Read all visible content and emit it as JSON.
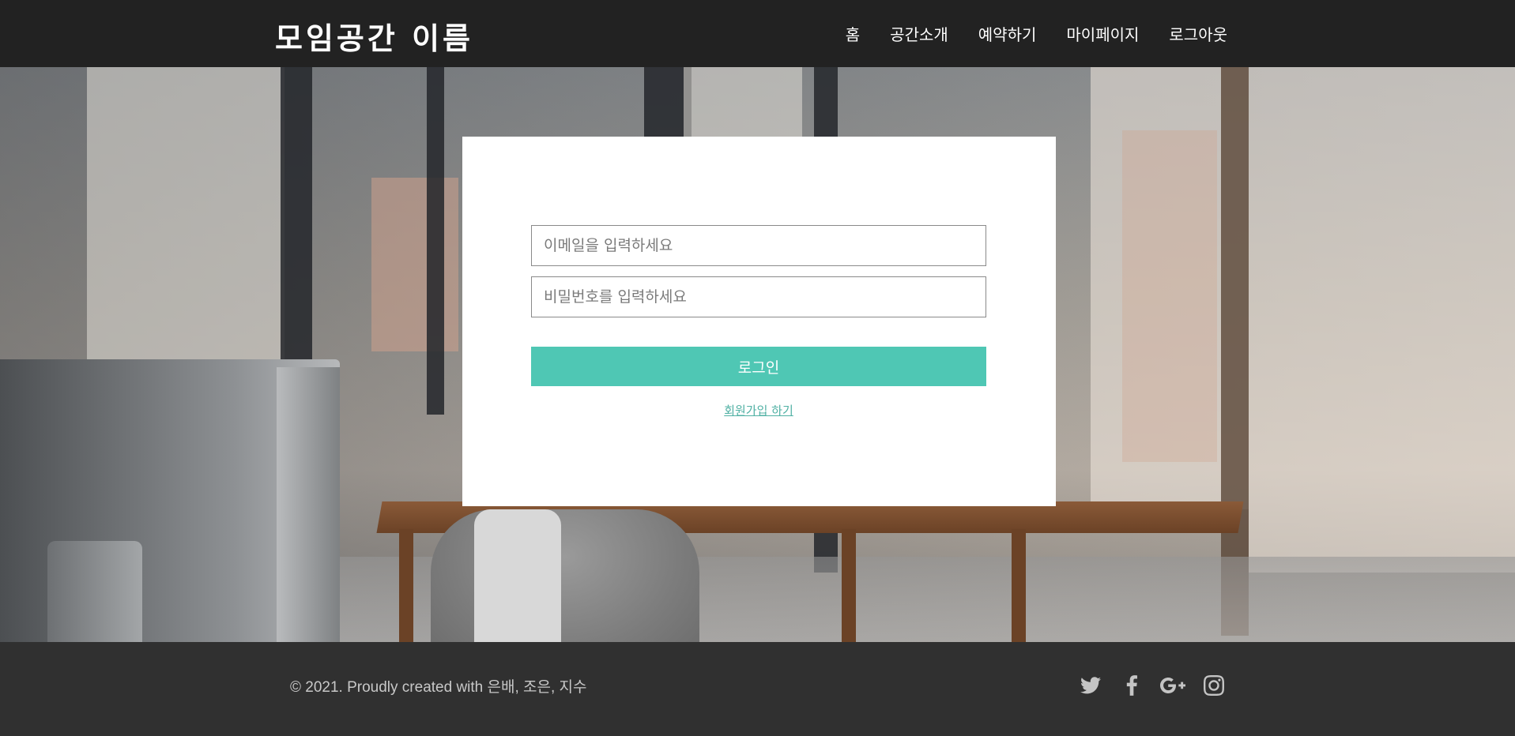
{
  "header": {
    "site_title": "모임공간 이름",
    "nav": [
      {
        "label": "홈"
      },
      {
        "label": "공간소개"
      },
      {
        "label": "예약하기"
      },
      {
        "label": "마이페이지"
      },
      {
        "label": "로그아웃"
      }
    ]
  },
  "login": {
    "email_placeholder": "이메일을 입력하세요",
    "email_value": "",
    "password_placeholder": "비밀번호를 입력하세요",
    "password_value": "",
    "submit_label": "로그인",
    "signup_label": "회원가입 하기"
  },
  "footer": {
    "copyright": "© 2021. Proudly created with 은배, 조은, 지수",
    "social": [
      {
        "icon": "twitter-icon"
      },
      {
        "icon": "facebook-icon"
      },
      {
        "icon": "google-plus-icon"
      },
      {
        "icon": "instagram-icon"
      }
    ]
  },
  "colors": {
    "header_bg": "#222222",
    "footer_bg": "#303030",
    "accent": "#4fc7b4",
    "card_bg": "#ffffff"
  }
}
